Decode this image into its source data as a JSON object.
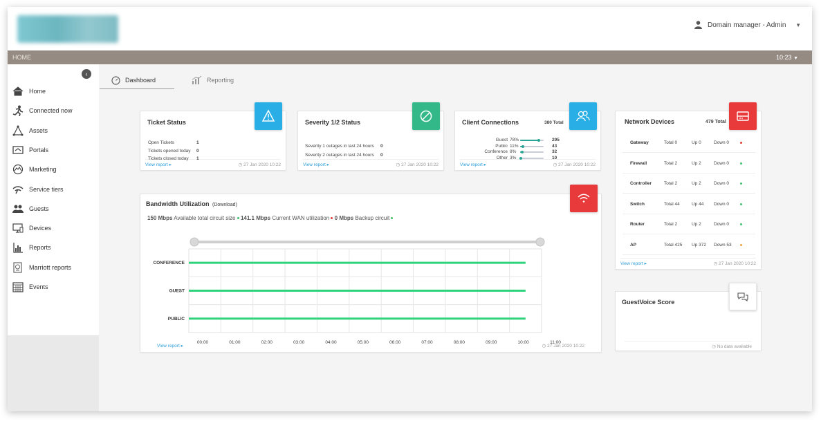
{
  "header": {
    "user_label": "Domain manager - Admin"
  },
  "topbar": {
    "breadcrumb": "HOME",
    "time": "10:23"
  },
  "sidebar": {
    "items": [
      {
        "label": "Home",
        "icon": "home-icon"
      },
      {
        "label": "Connected now",
        "icon": "running-person-icon"
      },
      {
        "label": "Assets",
        "icon": "network-triangle-icon"
      },
      {
        "label": "Portals",
        "icon": "portal-icon"
      },
      {
        "label": "Marketing",
        "icon": "marketing-icon"
      },
      {
        "label": "Service tiers",
        "icon": "wifi-signal-icon"
      },
      {
        "label": "Guests",
        "icon": "guests-icon"
      },
      {
        "label": "Devices",
        "icon": "devices-icon"
      },
      {
        "label": "Reports",
        "icon": "reports-chart-icon"
      },
      {
        "label": "Marriott reports",
        "icon": "document-report-icon"
      },
      {
        "label": "Events",
        "icon": "calendar-icon"
      }
    ]
  },
  "tabs": {
    "dashboard": "Dashboard",
    "reporting": "Reporting"
  },
  "common": {
    "view_report": "View report",
    "timestamp": "27 Jan 2020 10:22"
  },
  "ticket_status": {
    "title": "Ticket Status",
    "rows": [
      {
        "label": "Open Tickets",
        "value": "1"
      },
      {
        "label": "Tickets opened today",
        "value": "0"
      },
      {
        "label": "Tickets closed today",
        "value": "1"
      }
    ]
  },
  "severity": {
    "title": "Severity 1/2 Status",
    "rows": [
      {
        "label": "Severity 1 outages in last 24 hours",
        "value": "0"
      },
      {
        "label": "Severity 2 outages in last 24 hours",
        "value": "0"
      }
    ]
  },
  "client_connections": {
    "title": "Client Connections",
    "total": "380 Total",
    "rows": [
      {
        "label": "Guest",
        "pct": "78%",
        "value": "295",
        "fraction": 0.78
      },
      {
        "label": "Public",
        "pct": "11%",
        "value": "43",
        "fraction": 0.11
      },
      {
        "label": "Conference",
        "pct": "8%",
        "value": "32",
        "fraction": 0.08
      },
      {
        "label": "Other",
        "pct": "3%",
        "value": "10",
        "fraction": 0.03
      }
    ]
  },
  "network_devices": {
    "title": "Network Devices",
    "total": "479 Total",
    "rows": [
      {
        "name": "Gateway",
        "total": "Total 0",
        "up": "Up 0",
        "down": "Down 0",
        "status_color": "#e53935"
      },
      {
        "name": "Firewall",
        "total": "Total 2",
        "up": "Up 2",
        "down": "Down 0",
        "status_color": "#3ec46d"
      },
      {
        "name": "Controller",
        "total": "Total 2",
        "up": "Up 2",
        "down": "Down 0",
        "status_color": "#3ec46d"
      },
      {
        "name": "Switch",
        "total": "Total 44",
        "up": "Up 44",
        "down": "Down 0",
        "status_color": "#3ec46d"
      },
      {
        "name": "Router",
        "total": "Total 2",
        "up": "Up 2",
        "down": "Down 0",
        "status_color": "#3ec46d"
      },
      {
        "name": "AP",
        "total": "Total 425",
        "up": "Up 372",
        "down": "Down 53",
        "status_color": "#f2a33a"
      }
    ]
  },
  "bandwidth": {
    "title": "Bandwidth Utilization",
    "subtitle": "(Download)",
    "available": "150 Mbps",
    "available_label": "Available total circuit size",
    "wan": "141.1 Mbps",
    "wan_label": "Current WAN utilization",
    "backup": "0 Mbps",
    "backup_label": "Backup circuit"
  },
  "guestvoice": {
    "title": "GuestVoice Score",
    "empty": "No data available"
  },
  "colors": {
    "ticket_badge": "#29aee6",
    "severity_badge": "#33b889",
    "client_badge": "#29aee6",
    "network_badge": "#e83a3a",
    "bandwidth_badge": "#e83a3a",
    "bar": "#2dd27a",
    "link": "#2c9ed8"
  },
  "chart_data": {
    "type": "bar",
    "orientation": "horizontal",
    "categories": [
      "CONFERENCE",
      "GUEST",
      "PUBLIC"
    ],
    "x_ticks": [
      "00:00",
      "01:00",
      "02:00",
      "03:00",
      "04:00",
      "05:00",
      "06:00",
      "07:00",
      "08:00",
      "09:00",
      "10:00",
      "11:00"
    ],
    "series": [
      {
        "start": [
          "00:00",
          "00:00",
          "00:00"
        ],
        "end": [
          "10:30",
          "10:30",
          "10:30"
        ]
      }
    ],
    "grid": true
  }
}
